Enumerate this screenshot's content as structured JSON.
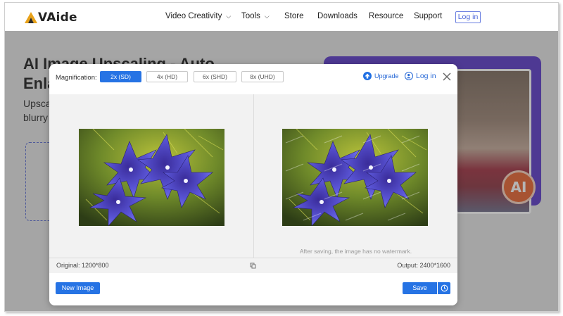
{
  "header": {
    "brand": "VAide",
    "nav": [
      {
        "label": "Video Creativity",
        "dropdown": true
      },
      {
        "label": "Tools",
        "dropdown": true
      },
      {
        "label": "Store",
        "dropdown": false
      },
      {
        "label": "Downloads",
        "dropdown": false
      },
      {
        "label": "Resource",
        "dropdown": false
      },
      {
        "label": "Support",
        "dropdown": false
      }
    ],
    "login": "Log in",
    "chevron_glyph": "⌵"
  },
  "hero": {
    "title_line1": "AI Image Upscaling - Auto",
    "title_line2": "Enla",
    "sub_line1": "Upsca",
    "sub_line2": "blurry",
    "badge": "AI"
  },
  "modal": {
    "magnification_label": "Magnification:",
    "options": [
      "2x (SD)",
      "4x (HD)",
      "6x (SHD)",
      "8x (UHD)"
    ],
    "selected": "2x (SD)",
    "upgrade": "Upgrade",
    "login": "Log in",
    "watermark_note": "After saving, the image has no watermark.",
    "original": "Original: 1200*800",
    "output": "Output: 2400*1600",
    "new_image": "New Image",
    "save": "Save"
  },
  "colors": {
    "accent": "#2673e4",
    "hero_card": "#5a38c9",
    "badge": "#e8612c"
  },
  "icons": [
    "logo-triangle-icon",
    "chevron-down-icon",
    "upgrade-icon",
    "user-icon",
    "close-icon",
    "compare-icon",
    "history-icon"
  ]
}
